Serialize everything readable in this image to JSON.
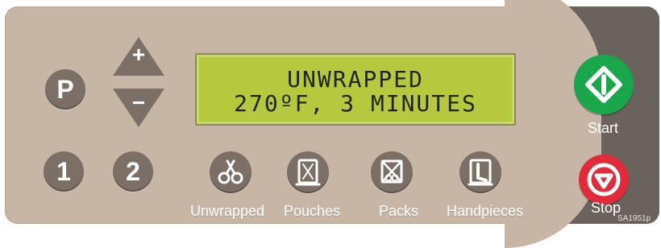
{
  "controls": {
    "program_button": "P",
    "plus_button": "+",
    "minus_button": "−",
    "preset_1": "1",
    "preset_2": "2"
  },
  "display": {
    "line1": "UNWRAPPED",
    "line2": "270ºF,  3 MINUTES"
  },
  "functions": [
    {
      "label": "Unwrapped",
      "icon": "scissors-icon"
    },
    {
      "label": "Pouches",
      "icon": "pouch-icon"
    },
    {
      "label": "Packs",
      "icon": "pack-icon"
    },
    {
      "label": "Handpieces",
      "icon": "handpiece-icon"
    }
  ],
  "actions": {
    "start_label": "Start",
    "stop_label": "Stop"
  },
  "footer": {
    "code": "SA1951p"
  },
  "colors": {
    "panel": "#c7b6a5",
    "button": "#7b6f66",
    "lcd": "#b6c93e",
    "start": "#1aa64a",
    "stop": "#e12a3a",
    "right_strip": "#6a625d"
  }
}
